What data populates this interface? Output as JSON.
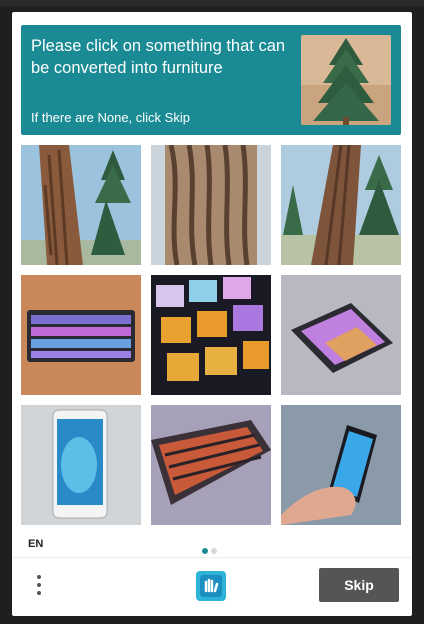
{
  "challenge": {
    "prompt": "Please click on something that can be converted into furniture",
    "subprompt": "If there are None, click Skip"
  },
  "tiles": [
    {
      "subject": "tree-trunk"
    },
    {
      "subject": "tree-bark"
    },
    {
      "subject": "tree-trunk"
    },
    {
      "subject": "keyboard"
    },
    {
      "subject": "keyboard"
    },
    {
      "subject": "smartphone"
    },
    {
      "subject": "smartphone"
    },
    {
      "subject": "keyboard"
    },
    {
      "subject": "smartphone"
    }
  ],
  "footer": {
    "language": "EN",
    "skip_label": "Skip",
    "page_indicator": {
      "current": 1,
      "total": 2
    }
  },
  "colors": {
    "header_bg": "#1a8a94",
    "dot_active": "#1a8a94",
    "dot_inactive": "#d8d8d8",
    "skip_bg": "#555555"
  }
}
